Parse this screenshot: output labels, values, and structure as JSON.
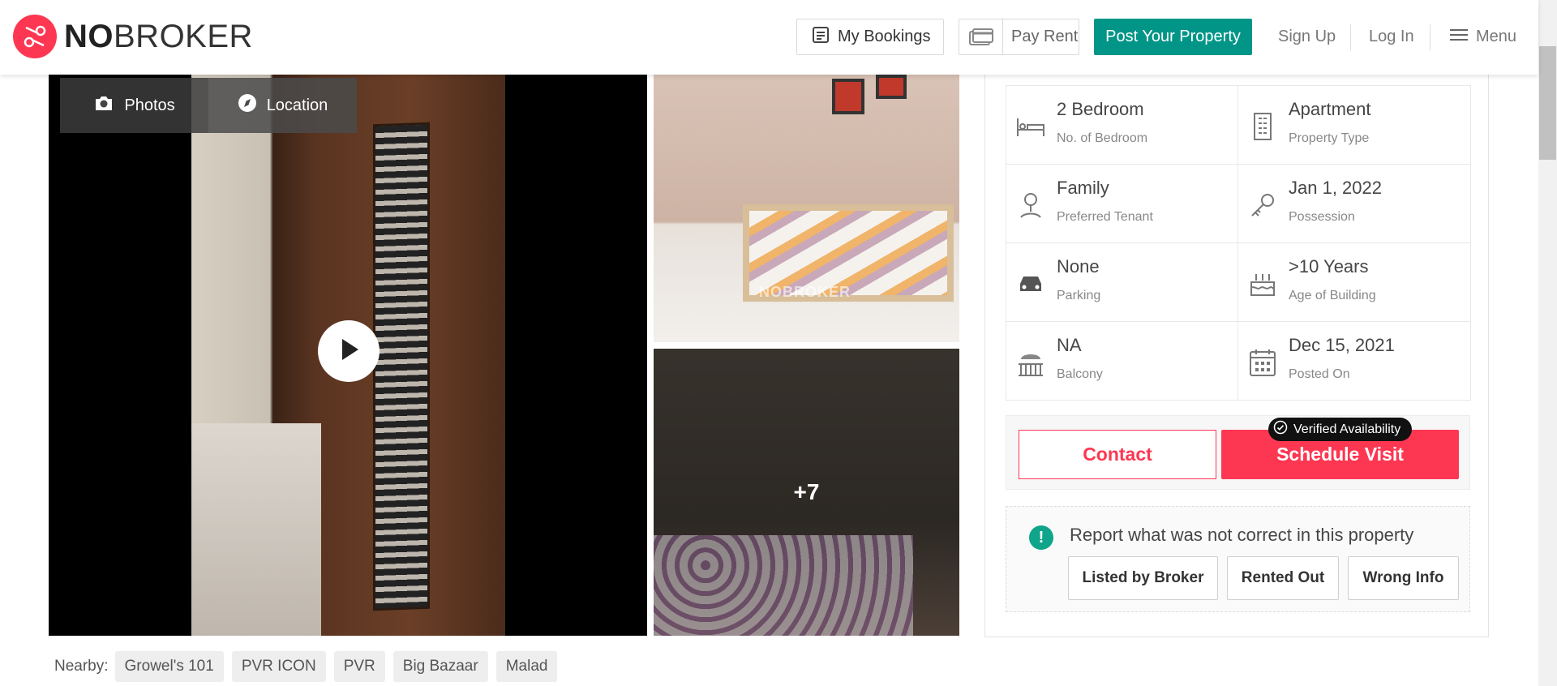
{
  "header": {
    "logo": {
      "bold": "NO",
      "rest": "BROKER"
    },
    "my_bookings": "My Bookings",
    "pay_rent": "Pay Rent",
    "post_property": "Post Your Property",
    "sign_up": "Sign Up",
    "log_in": "Log In",
    "menu": "Menu"
  },
  "gallery": {
    "tabs": {
      "photos": "Photos",
      "location": "Location"
    },
    "more_count": "+7",
    "watermark": "NOBROKER"
  },
  "details": [
    {
      "value": "2 Bedroom",
      "label": "No. of Bedroom",
      "icon": "bed-icon"
    },
    {
      "value": "Apartment",
      "label": "Property Type",
      "icon": "building-icon"
    },
    {
      "value": "Family",
      "label": "Preferred Tenant",
      "icon": "tenant-icon"
    },
    {
      "value": "Jan 1, 2022",
      "label": "Possession",
      "icon": "key-icon"
    },
    {
      "value": "None",
      "label": "Parking",
      "icon": "car-icon"
    },
    {
      "value": ">10 Years",
      "label": "Age of Building",
      "icon": "cake-icon"
    },
    {
      "value": "NA",
      "label": "Balcony",
      "icon": "balcony-icon"
    },
    {
      "value": "Dec 15, 2021",
      "label": "Posted On",
      "icon": "calendar-icon"
    }
  ],
  "cta": {
    "contact": "Contact",
    "schedule_visit": "Schedule Visit",
    "verified_badge": "Verified Availability"
  },
  "report": {
    "title": "Report what was not correct in this property",
    "buttons": [
      "Listed by Broker",
      "Rented Out",
      "Wrong Info"
    ]
  },
  "nearby": {
    "label": "Nearby:",
    "places": [
      "Growel's 101",
      "PVR ICON",
      "PVR",
      "Big Bazaar",
      "Malad"
    ]
  },
  "colors": {
    "brand_red": "#fd3752",
    "brand_teal": "#009587"
  }
}
